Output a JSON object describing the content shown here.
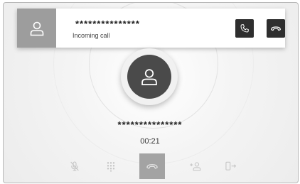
{
  "banner": {
    "caller": "***************",
    "status": "Incoming call",
    "answer_icon": "phone-answer-icon",
    "decline_icon": "phone-decline-icon"
  },
  "call": {
    "caller": "***************",
    "duration": "00:21"
  },
  "toolbar": {
    "items": [
      {
        "icon": "mute-microphone-icon"
      },
      {
        "icon": "keypad-icon"
      },
      {
        "icon": "end-call-icon"
      },
      {
        "icon": "add-participant-icon"
      },
      {
        "icon": "transfer-audio-icon"
      }
    ]
  },
  "colors": {
    "dark_button": "#2e2e2e",
    "avatar_gray": "#9d9d9d",
    "end_button_gray": "#a3a3a3"
  }
}
